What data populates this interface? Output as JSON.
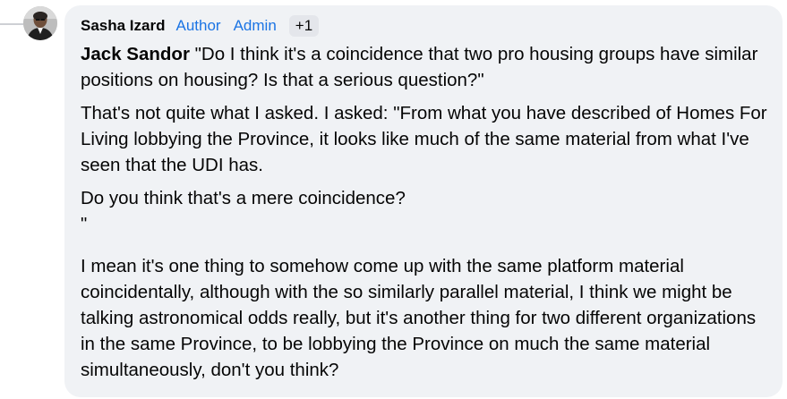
{
  "comment": {
    "author": "Sasha Izard",
    "badges": [
      "Author",
      "Admin"
    ],
    "badge_more": "+1",
    "mention": "Jack Sandor",
    "paragraph_1_rest": " \"Do I think it's a coincidence that two pro housing groups have similar positions on housing? Is that a serious question?\"",
    "paragraph_2": "That's not quite what I asked. I asked: \"From what you have described of Homes For Living lobbying the Province, it looks like much of the same material from what I've seen that the UDI has.",
    "paragraph_3": "Do you think that's a mere coincidence?",
    "paragraph_3_quote": "\"",
    "paragraph_4": "I mean it's one thing to somehow come up with the same platform material coincidentally, although with the so similarly parallel material, I think we might be talking astronomical odds really, but it's another thing for two different organizations in the same Province, to be lobbying the Province on much the same material simultaneously, don't you think?"
  },
  "colors": {
    "bubble_bg": "#f0f2f5",
    "badge_text": "#1b74e4",
    "text": "#050505"
  },
  "icons": {
    "avatar": "profile-photo"
  }
}
